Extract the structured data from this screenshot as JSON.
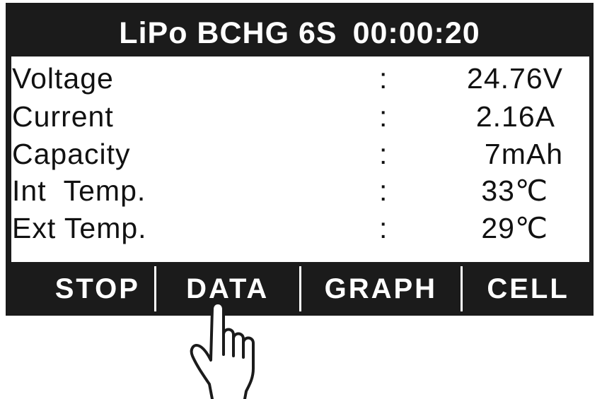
{
  "title": {
    "mode": "LiPo BCHG 6S",
    "timer": "00:00:20"
  },
  "readings": [
    {
      "label": "Voltage",
      "value": "24.76V"
    },
    {
      "label": "Current",
      "value": "2.16A"
    },
    {
      "label": "Capacity",
      "value": "7mAh"
    },
    {
      "label": "Int  Temp.",
      "value": "33℃"
    },
    {
      "label": "Ext Temp.",
      "value": "29℃"
    }
  ],
  "separator": ":",
  "softkeys": {
    "stop": "STOP",
    "data": "DATA",
    "graph": "GRAPH",
    "cell": "CELL"
  },
  "colors": {
    "lcd_background": "#1b1b1b",
    "text_light": "#ffffff",
    "text_dark": "#111111"
  },
  "icons": {
    "pointer": "pointing-hand-icon"
  }
}
